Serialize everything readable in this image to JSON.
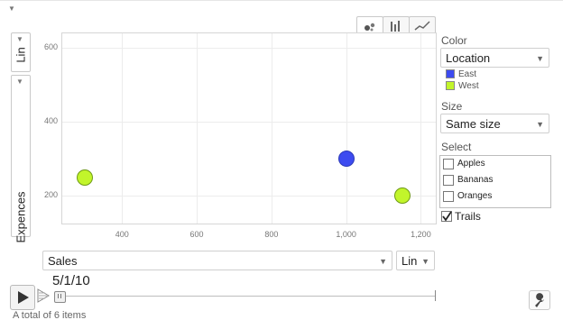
{
  "colors": {
    "east": "#3d4bf0",
    "west": "#c2f52b",
    "east_border": "#2c3ab8",
    "west_border": "#6f9a16"
  },
  "left_controls": {
    "scale_label": "Lin",
    "y_axis_label": "Expences"
  },
  "chart_type_tabs": [
    {
      "icon": "bubble-chart-icon",
      "active": true
    },
    {
      "icon": "bar-chart-icon",
      "active": false
    },
    {
      "icon": "line-chart-icon",
      "active": false
    }
  ],
  "chart_data": {
    "type": "scatter",
    "xlim": [
      240,
      1240
    ],
    "ylim": [
      125,
      640
    ],
    "xticks": [
      "400",
      "600",
      "800",
      "1,000",
      "1,200"
    ],
    "xtick_values": [
      400,
      600,
      800,
      1000,
      1200
    ],
    "yticks": [
      "600",
      "400",
      "200"
    ],
    "ytick_values": [
      600,
      400,
      200
    ],
    "grid": true,
    "points": [
      {
        "x": 1000,
        "y": 300,
        "location": "East"
      },
      {
        "x": 300,
        "y": 250,
        "location": "West"
      },
      {
        "x": 1150,
        "y": 200,
        "location": "West"
      }
    ]
  },
  "right_panel": {
    "color_label": "Color",
    "color_value": "Location",
    "legend": [
      {
        "name": "East"
      },
      {
        "name": "West"
      }
    ],
    "size_label": "Size",
    "size_value": "Same size",
    "select_label": "Select",
    "items": [
      {
        "label": "Apples",
        "checked": false
      },
      {
        "label": "Bananas",
        "checked": false
      },
      {
        "label": "Oranges",
        "checked": false
      }
    ],
    "trails_label": "Trails",
    "trails_checked": true
  },
  "x_axis_controls": {
    "variable": "Sales",
    "scale": "Lin"
  },
  "player": {
    "date": "5/1/10"
  },
  "footer": {
    "count_text": "A total of 6 items"
  }
}
